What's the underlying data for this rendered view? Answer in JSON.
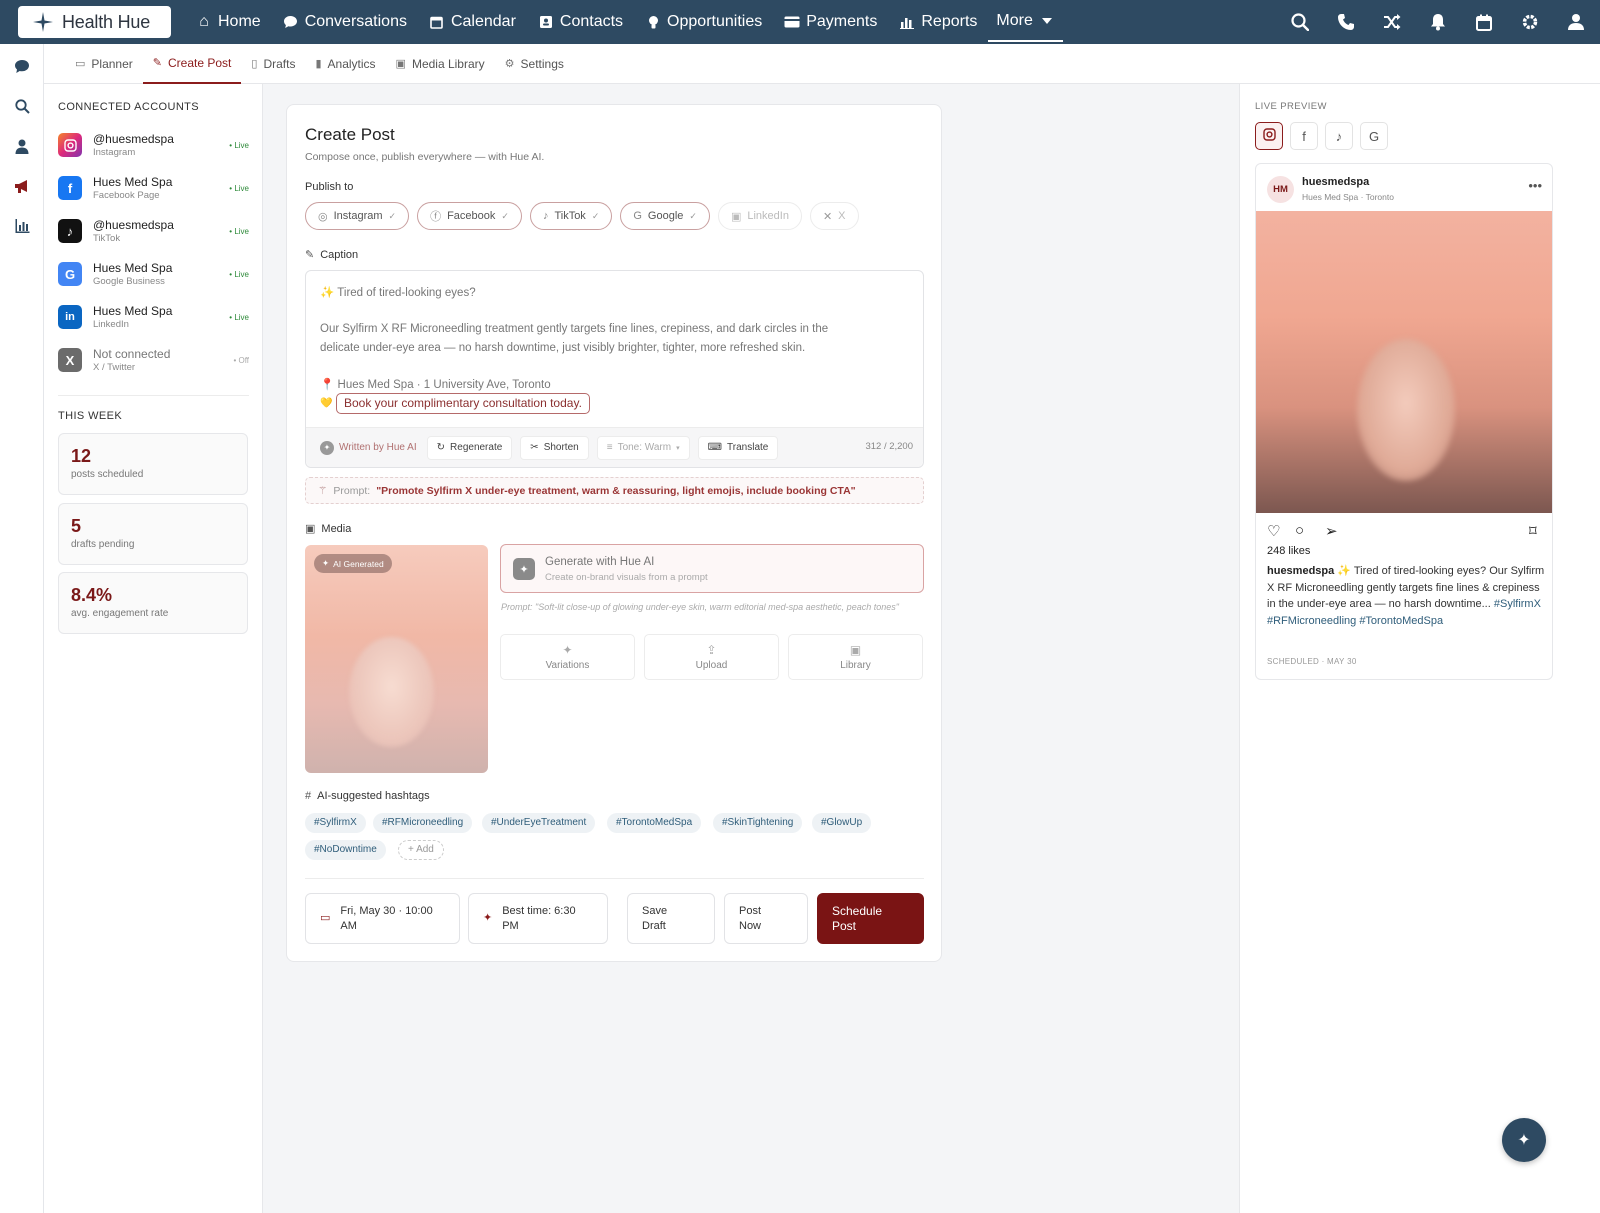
{
  "app": {
    "logo_text": "Health Hue",
    "accent": "#7a1414",
    "nav_bg": "#2e4a62"
  },
  "topnav": {
    "items": [
      {
        "label": "Home",
        "icon": "home-icon"
      },
      {
        "label": "Conversations",
        "icon": "chat-icon"
      },
      {
        "label": "Calendar",
        "icon": "calendar-icon"
      },
      {
        "label": "Contacts",
        "icon": "contacts-icon"
      },
      {
        "label": "Opportunities",
        "icon": "lightbulb-icon"
      },
      {
        "label": "Payments",
        "icon": "credit-card-icon"
      },
      {
        "label": "Reports",
        "icon": "bar-chart-icon"
      },
      {
        "label": "More",
        "icon": "caret-down-icon"
      }
    ],
    "right_icons": [
      "search-icon",
      "phone-icon",
      "shuffle-icon",
      "bell-icon",
      "calendar-icon",
      "gear-icon",
      "user-icon"
    ]
  },
  "rail_icons": [
    "chat-icon",
    "search-icon",
    "user-icon",
    "megaphone-icon",
    "bar-chart-icon"
  ],
  "subnav": {
    "tabs": [
      {
        "label": "Planner",
        "icon": "calendar-icon"
      },
      {
        "label": "Create Post",
        "icon": "edit-icon",
        "active": true
      },
      {
        "label": "Drafts",
        "icon": "document-icon"
      },
      {
        "label": "Analytics",
        "icon": "bar-chart-icon"
      },
      {
        "label": "Media Library",
        "icon": "image-icon"
      },
      {
        "label": "Settings",
        "icon": "gear-icon"
      }
    ]
  },
  "left": {
    "accounts_title": "CONNECTED ACCOUNTS",
    "accounts": [
      {
        "name": "@huesmedspa",
        "sub": "Instagram",
        "status": "• Live",
        "icon": "instagram-icon",
        "color": "#e1306c"
      },
      {
        "name": "Hues Med Spa",
        "sub": "Facebook Page",
        "status": "• Live",
        "icon": "facebook-icon",
        "color": "#1877f2"
      },
      {
        "name": "@huesmedspa",
        "sub": "TikTok",
        "status": "• Live",
        "icon": "tiktok-icon",
        "color": "#111111"
      },
      {
        "name": "Hues Med Spa",
        "sub": "Google Business",
        "status": "• Live",
        "icon": "google-icon",
        "color": "#4285f4"
      },
      {
        "name": "Hues Med Spa",
        "sub": "LinkedIn",
        "status": "• Live",
        "icon": "linkedin-icon",
        "color": "#0a66c2"
      },
      {
        "name": "Not connected",
        "sub": "X / Twitter",
        "status": "• Off",
        "icon": "x-icon",
        "color": "#666666"
      }
    ],
    "week_title": "THIS WEEK",
    "stats": [
      {
        "value": "12",
        "label": "posts scheduled"
      },
      {
        "value": "5",
        "label": "drafts pending"
      },
      {
        "value": "8.4%",
        "label": "avg. engagement rate"
      }
    ]
  },
  "main": {
    "title": "Create Post",
    "subtitle": "Compose once, publish everywhere — with Hue AI.",
    "publish_to_label": "Publish to",
    "platforms": [
      {
        "label": "Instagram",
        "selected": true
      },
      {
        "label": "Facebook",
        "selected": true
      },
      {
        "label": "TikTok",
        "selected": true
      },
      {
        "label": "Google",
        "selected": true
      },
      {
        "label": "LinkedIn",
        "selected": false
      },
      {
        "label": "X",
        "selected": false
      }
    ],
    "caption_label": "Caption",
    "caption": {
      "line1": "✨ Tired of tired-looking eyes?",
      "line2": "Our Sylfirm X RF Microneedling treatment gently targets fine lines, crepiness, and dark circles in the",
      "line3": "delicate under-eye area — no harsh downtime, just visibly brighter, tighter, more refreshed skin.",
      "line4": "📍 Hues Med Spa · 1 University Ave, Toronto",
      "cta": "Book your complimentary consultation today."
    },
    "toolbar": {
      "written_by": "Written by Hue AI",
      "regenerate": "Regenerate",
      "shorten": "Shorten",
      "tone": "Tone: Warm",
      "translate": "Translate",
      "char_count": "312 / 2,200"
    },
    "prompt_label": "Prompt:",
    "prompt_text": "\"Promote Sylfirm X under-eye treatment, warm & reassuring, light emojis, include booking CTA\"",
    "media_label": "Media",
    "ai_badge": "AI Generated",
    "generate": {
      "title": "Generate with Hue AI",
      "sub": "Create on-brand visuals from a prompt",
      "prompt": "Prompt: \"Soft-lit close-up of glowing under-eye skin, warm editorial med-spa aesthetic, peach tones\""
    },
    "media_options": [
      "Variations",
      "Upload",
      "Library"
    ],
    "hashtags_label": "AI-suggested hashtags",
    "hashtags": [
      "#SylfirmX",
      "#RFMicroneedling",
      "#UnderEyeTreatment",
      "#TorontoMedSpa",
      "#SkinTightening",
      "#GlowUp",
      "#NoDowntime"
    ],
    "add_tag": "+ Add",
    "schedule": {
      "date_line1": "Fri, May 30 · 10:00",
      "date_line2": "AM",
      "best_line1": "Best time: 6:30",
      "best_line2": "PM",
      "save_line1": "Save",
      "save_line2": "Draft",
      "post_line1": "Post",
      "post_line2": "Now",
      "schedule_line1": "Schedule",
      "schedule_line2": "Post"
    }
  },
  "preview": {
    "title": "LIVE PREVIEW",
    "tabs": [
      "instagram-icon",
      "facebook-icon",
      "tiktok-icon",
      "google-icon"
    ],
    "avatar": "HM",
    "username": "huesmedspa",
    "location": "Hues Med Spa · Toronto",
    "likes": "248 likes",
    "caption_user": "huesmedspa",
    "caption_text": "✨ Tired of tired-looking eyes? Our Sylfirm X RF Microneedling gently targets fine lines & crepiness in the under-eye area — no harsh downtime...",
    "caption_tags": "#SylfirmX #RFMicroneedling #TorontoMedSpa",
    "scheduled": "SCHEDULED · MAY 30"
  }
}
